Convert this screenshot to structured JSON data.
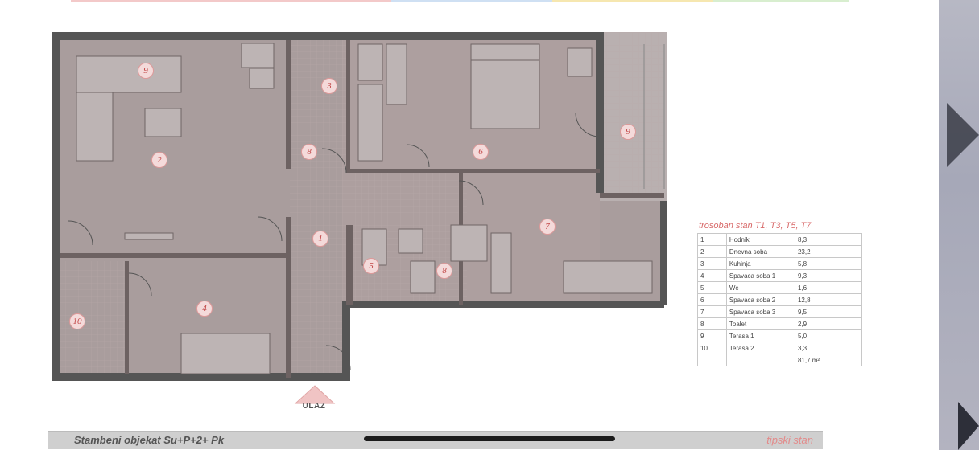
{
  "plan": {
    "room_markers": [
      "9",
      "3",
      "2",
      "8",
      "6",
      "9",
      "1",
      "7",
      "5",
      "8",
      "4",
      "10"
    ],
    "entrance_label": "ULAZ"
  },
  "legend": {
    "title": "trosoban stan T1, T3, T5, T7",
    "rows": [
      {
        "no": "1",
        "name": "Hodnik",
        "area": "8,3"
      },
      {
        "no": "2",
        "name": "Dnevna soba",
        "area": "23,2"
      },
      {
        "no": "3",
        "name": "Kuhinja",
        "area": "5,8"
      },
      {
        "no": "4",
        "name": "Spavaca soba 1",
        "area": "9,3"
      },
      {
        "no": "5",
        "name": "Wc",
        "area": "1,6"
      },
      {
        "no": "6",
        "name": "Spavaca soba 2",
        "area": "12,8"
      },
      {
        "no": "7",
        "name": "Spavaca soba 3",
        "area": "9,5"
      },
      {
        "no": "8",
        "name": "Toalet",
        "area": "2,9"
      },
      {
        "no": "9",
        "name": "Terasa 1",
        "area": "5,0"
      },
      {
        "no": "10",
        "name": "Terasa 2",
        "area": "3,3"
      }
    ],
    "total": "81,7 m²"
  },
  "footer": {
    "left": "Stambeni objekat Su+P+2+ Pk",
    "right": "tipski stan"
  },
  "colors": {
    "top_strip": [
      "#f3c9c9",
      "#cfe0f3",
      "#f6e7b0",
      "#d8eecf"
    ],
    "marker": "#c24848",
    "accent": "#d86a6a"
  }
}
